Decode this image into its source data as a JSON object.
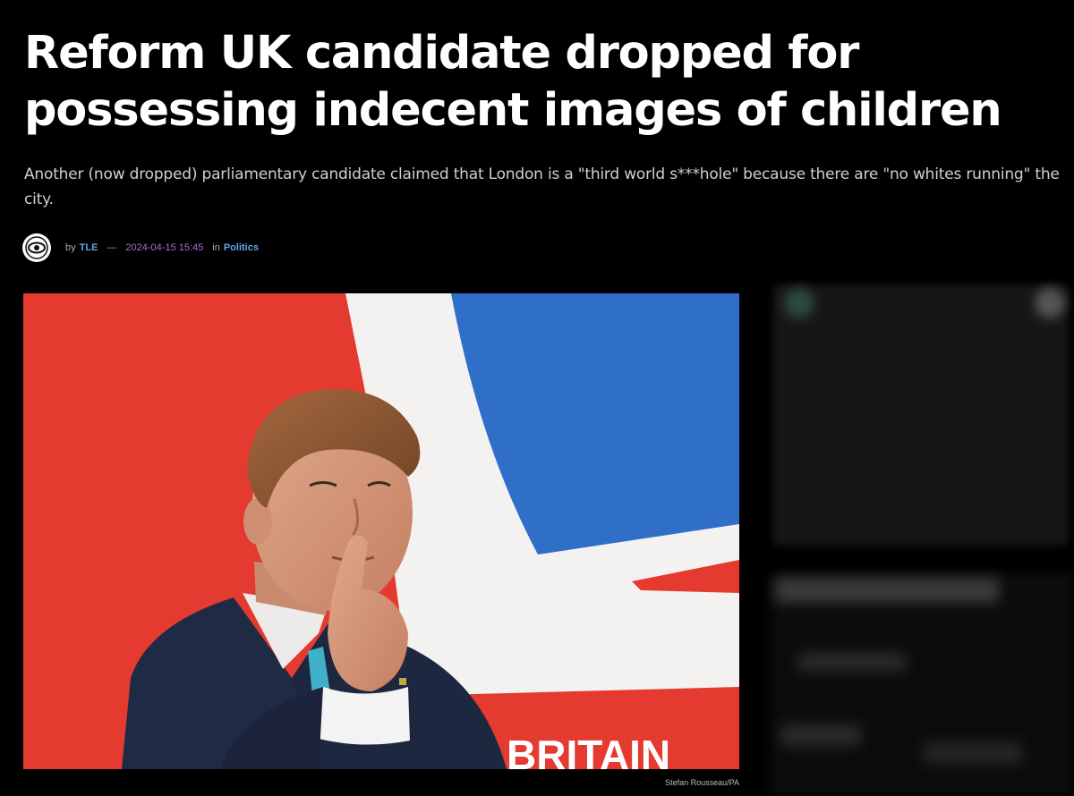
{
  "article": {
    "headline": "Reform UK candidate dropped for possessing indecent images of children",
    "standfirst": "Another (now dropped) parliamentary candidate claimed that London is a \"third world s***hole\" because there are \"no whites running\" the city.",
    "byline": {
      "logo_icon": "eye-logo-icon",
      "by_label": "by",
      "author": "TLE",
      "separator": "—",
      "date": "2024-04-15 15:45",
      "in_label": "in",
      "category": "Politics"
    },
    "hero_image": {
      "description_icon": "photo-man-thinking-union-flag",
      "caption": "Stefan Rousseau/PA"
    }
  },
  "colors": {
    "background": "#000000",
    "headline": "#ffffff",
    "standfirst": "#cfcfcf",
    "link": "#5fa8ee",
    "date": "#b06bd6",
    "flag_red": "#e53a30",
    "flag_blue": "#2f6fc8",
    "flag_white": "#f5f5f5"
  }
}
